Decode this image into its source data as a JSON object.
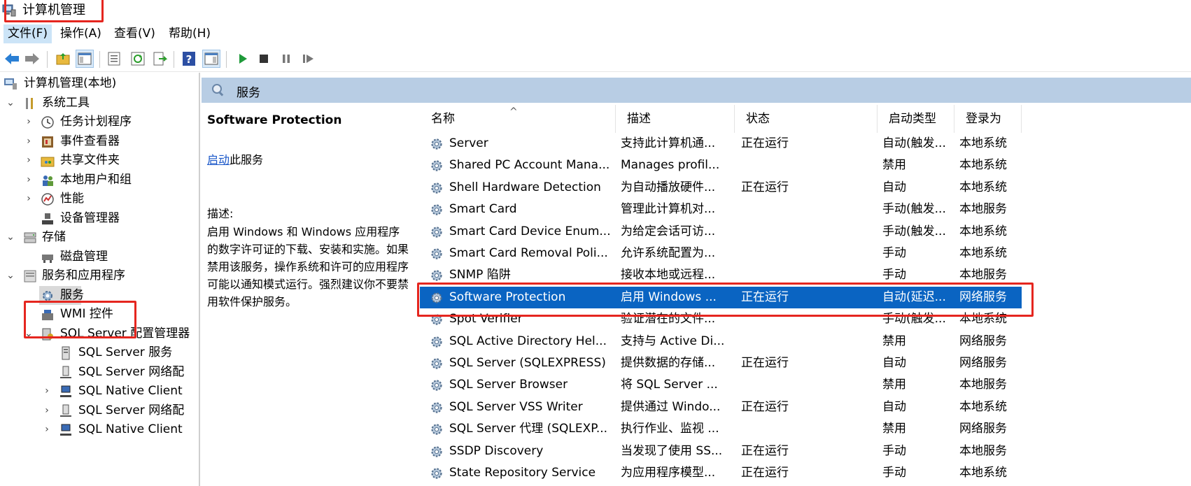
{
  "window": {
    "title": "计算机管理"
  },
  "menu": [
    "文件(F)",
    "操作(A)",
    "查看(V)",
    "帮助(H)"
  ],
  "tree": {
    "root": "计算机管理(本地)",
    "system_tools": "系统工具",
    "task_scheduler": "任务计划程序",
    "event_viewer": "事件查看器",
    "shared_folders": "共享文件夹",
    "local_users": "本地用户和组",
    "performance": "性能",
    "device_manager": "设备管理器",
    "storage": "存储",
    "disk_management": "磁盘管理",
    "services_apps": "服务和应用程序",
    "services": "服务",
    "wmi": "WMI 控件",
    "sql_config": "SQL Server 配置管理器",
    "sql_services": "SQL Server 服务",
    "sql_network_1": "SQL Server 网络配",
    "sql_native_1": "SQL Native Client",
    "sql_network_2": "SQL Server 网络配",
    "sql_native_2": "SQL Native Client"
  },
  "panel": {
    "header": "服务",
    "selected_name": "Software Protection",
    "action_link": "启动",
    "action_suffix": "此服务",
    "desc_label": "描述:",
    "desc_text": "启用 Windows 和 Windows 应用程序的数字许可证的下载、安装和实施。如果禁用该服务，操作系统和许可的应用程序可能以通知模式运行。强烈建议你不要禁用软件保护服务。"
  },
  "columns": [
    "名称",
    "描述",
    "状态",
    "启动类型",
    "登录为"
  ],
  "rows": [
    {
      "name": "Server",
      "desc": "支持此计算机通...",
      "status": "正在运行",
      "startup": "自动(触发...",
      "logon": "本地系统"
    },
    {
      "name": "Shared PC Account Mana...",
      "desc": "Manages profil...",
      "status": "",
      "startup": "禁用",
      "logon": "本地系统"
    },
    {
      "name": "Shell Hardware Detection",
      "desc": "为自动播放硬件...",
      "status": "正在运行",
      "startup": "自动",
      "logon": "本地系统"
    },
    {
      "name": "Smart Card",
      "desc": "管理此计算机对...",
      "status": "",
      "startup": "手动(触发...",
      "logon": "本地服务"
    },
    {
      "name": "Smart Card Device Enum...",
      "desc": "为给定会话可访...",
      "status": "",
      "startup": "手动(触发...",
      "logon": "本地系统"
    },
    {
      "name": "Smart Card Removal Poli...",
      "desc": "允许系统配置为...",
      "status": "",
      "startup": "手动",
      "logon": "本地系统"
    },
    {
      "name": "SNMP 陷阱",
      "desc": "接收本地或远程...",
      "status": "",
      "startup": "手动",
      "logon": "本地服务"
    },
    {
      "name": "Software Protection",
      "desc": "启用 Windows ...",
      "status": "正在运行",
      "startup": "自动(延迟...",
      "logon": "网络服务"
    },
    {
      "name": "Spot Verifier",
      "desc": "验证潜在的文件...",
      "status": "",
      "startup": "手动(触发...",
      "logon": "本地系统"
    },
    {
      "name": "SQL Active Directory Hel...",
      "desc": "支持与 Active Di...",
      "status": "",
      "startup": "禁用",
      "logon": "网络服务"
    },
    {
      "name": "SQL Server (SQLEXPRESS)",
      "desc": "提供数据的存储...",
      "status": "正在运行",
      "startup": "自动",
      "logon": "网络服务"
    },
    {
      "name": "SQL Server Browser",
      "desc": "将 SQL Server ...",
      "status": "",
      "startup": "禁用",
      "logon": "本地服务"
    },
    {
      "name": "SQL Server VSS Writer",
      "desc": "提供通过 Windo...",
      "status": "正在运行",
      "startup": "自动",
      "logon": "本地系统"
    },
    {
      "name": "SQL Server 代理 (SQLEXP...",
      "desc": "执行作业、监视 ...",
      "status": "",
      "startup": "禁用",
      "logon": "网络服务"
    },
    {
      "name": "SSDP Discovery",
      "desc": "当发现了使用 SS...",
      "status": "正在运行",
      "startup": "手动",
      "logon": "本地服务"
    },
    {
      "name": "State Repository Service",
      "desc": "为应用程序模型...",
      "status": "正在运行",
      "startup": "手动",
      "logon": "本地系统"
    }
  ],
  "selected_row_index": 7
}
